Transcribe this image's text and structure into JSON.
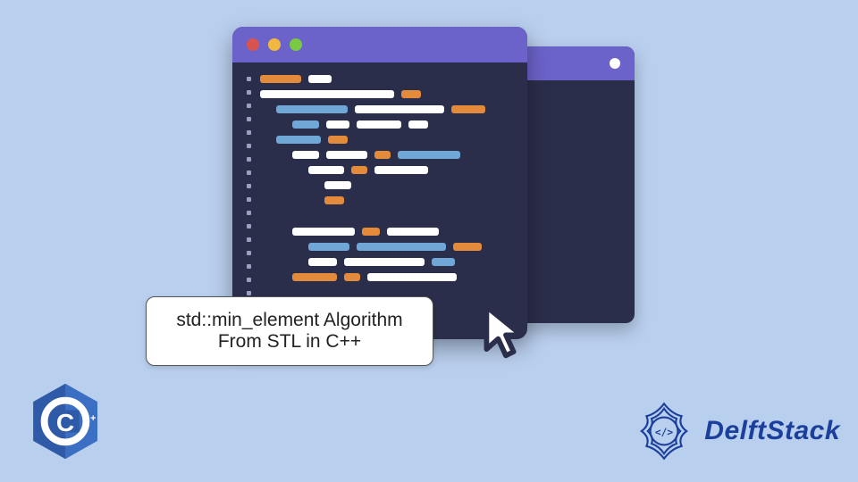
{
  "label": {
    "line1": "std::min_element Algorithm",
    "line2": "From STL in C++"
  },
  "brand": {
    "name": "DelftStack"
  },
  "cpp_badge": {
    "text": "C++"
  },
  "colors": {
    "bg": "#b9cfee",
    "window_body": "#2b2e4a",
    "titlebar": "#6b63c9",
    "traffic_red": "#d9534f",
    "traffic_yellow": "#f0b83f",
    "traffic_green": "#7ac943",
    "code_white": "#ffffff",
    "code_orange": "#e38b3a",
    "code_blue": "#6fa7d6",
    "brand_blue": "#1b3f9c",
    "cpp_blue": "#2f5aa8"
  },
  "code_lines": [
    {
      "indent": 0,
      "segs": [
        [
          "code_orange",
          46
        ],
        [
          "code_white",
          26
        ]
      ]
    },
    {
      "indent": 0,
      "segs": [
        [
          "code_white",
          150
        ],
        [
          "code_orange",
          22
        ]
      ]
    },
    {
      "indent": 1,
      "segs": [
        [
          "code_blue",
          80
        ],
        [
          "code_white",
          100
        ],
        [
          "code_orange",
          38
        ]
      ]
    },
    {
      "indent": 2,
      "segs": [
        [
          "code_blue",
          30
        ],
        [
          "code_white",
          26
        ],
        [
          "code_white",
          50
        ],
        [
          "code_white",
          22
        ]
      ]
    },
    {
      "indent": 1,
      "segs": [
        [
          "code_blue",
          50
        ],
        [
          "code_orange",
          22
        ]
      ]
    },
    {
      "indent": 2,
      "segs": [
        [
          "code_white",
          30
        ],
        [
          "code_white",
          46
        ],
        [
          "code_orange",
          18
        ],
        [
          "code_blue",
          70
        ]
      ]
    },
    {
      "indent": 3,
      "segs": [
        [
          "code_white",
          40
        ],
        [
          "code_orange",
          18
        ],
        [
          "code_white",
          60
        ]
      ]
    },
    {
      "indent": 4,
      "segs": [
        [
          "code_white",
          30
        ]
      ]
    },
    {
      "indent": 4,
      "segs": [
        [
          "code_orange",
          22
        ]
      ]
    },
    {
      "spacer": true
    },
    {
      "indent": 2,
      "segs": [
        [
          "code_white",
          70
        ],
        [
          "code_orange",
          20
        ],
        [
          "code_white",
          58
        ]
      ]
    },
    {
      "indent": 3,
      "segs": [
        [
          "code_blue",
          46
        ],
        [
          "code_blue",
          100
        ],
        [
          "code_orange",
          32
        ]
      ]
    },
    {
      "indent": 3,
      "segs": [
        [
          "code_white",
          32
        ],
        [
          "code_white",
          90
        ],
        [
          "code_blue",
          26
        ]
      ]
    },
    {
      "indent": 2,
      "segs": [
        [
          "code_orange",
          50
        ],
        [
          "code_orange",
          18
        ],
        [
          "code_white",
          100
        ]
      ]
    }
  ],
  "gutter_rows": 17
}
